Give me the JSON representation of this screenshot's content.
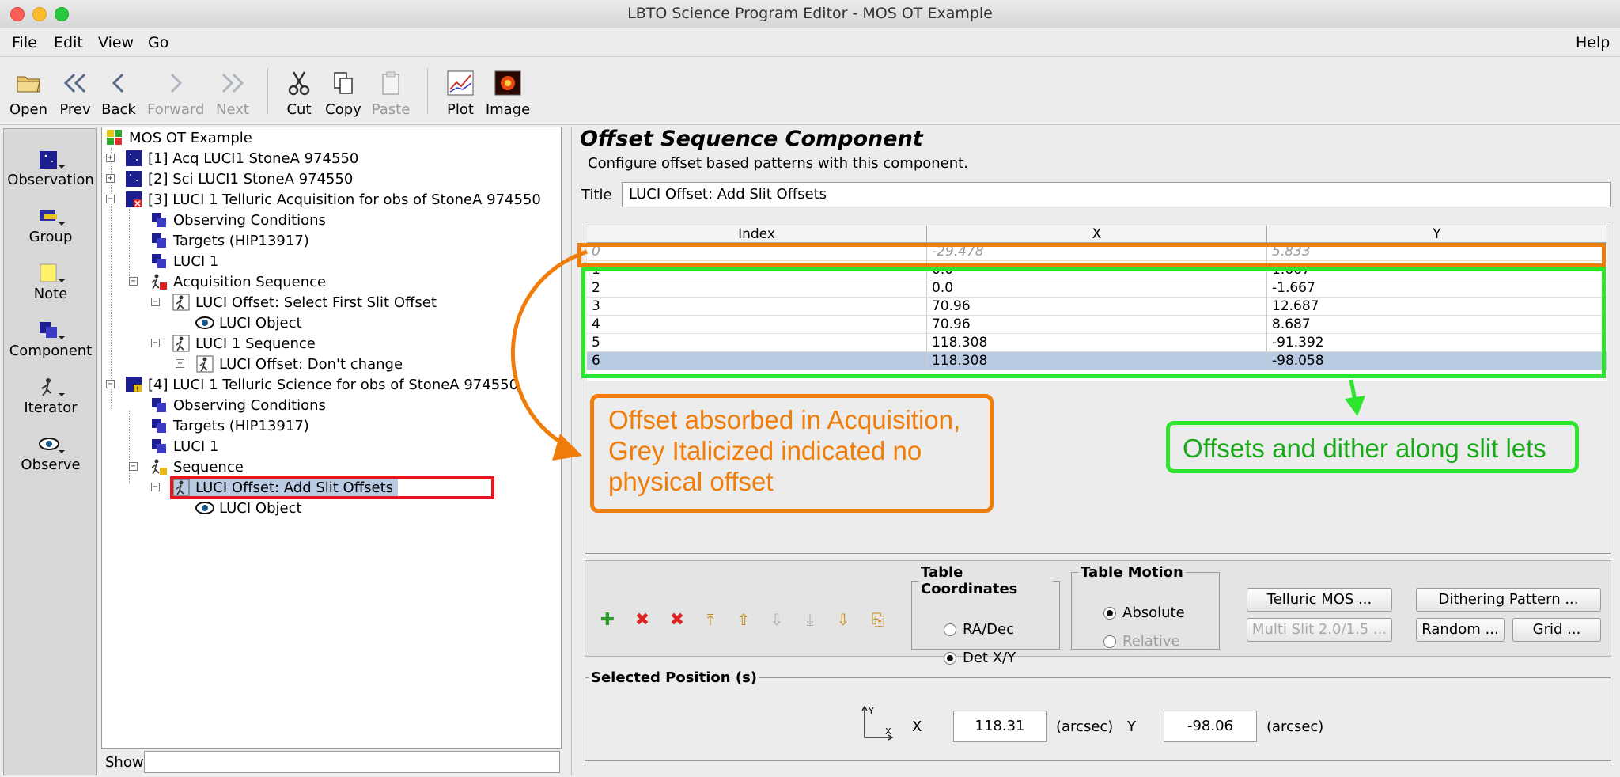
{
  "window": {
    "title": "LBTO Science Program Editor - MOS OT Example"
  },
  "menu": {
    "items": [
      "File",
      "Edit",
      "View",
      "Go"
    ],
    "help": "Help"
  },
  "toolbar": {
    "open": "Open",
    "prev": "Prev",
    "back": "Back",
    "forward": "Forward",
    "next": "Next",
    "cut": "Cut",
    "copy": "Copy",
    "paste": "Paste",
    "plot": "Plot",
    "image": "Image"
  },
  "palette": {
    "observation": "Observation",
    "group": "Group",
    "note": "Note",
    "component": "Component",
    "iterator": "Iterator",
    "observe": "Observe"
  },
  "tree": {
    "root": "MOS OT Example",
    "nodes": [
      "[1] Acq LUCI1 StoneA 974550",
      "[2] Sci LUCI1 StoneA 974550",
      "[3] LUCI 1 Telluric Acquisition for obs of StoneA 974550",
      "Observing Conditions",
      "Targets (HIP13917)",
      "LUCI 1",
      "Acquisition Sequence",
      "LUCI Offset: Select First Slit Offset",
      "LUCI Object",
      "LUCI 1 Sequence",
      "LUCI Offset: Don't change",
      "[4] LUCI 1 Telluric Science for obs of StoneA 974550",
      "Observing Conditions",
      "Targets (HIP13917)",
      "LUCI 1",
      "Sequence",
      "LUCI Offset: Add Slit Offsets",
      "LUCI Object"
    ],
    "show_label": "Show"
  },
  "component": {
    "heading": "Offset Sequence Component",
    "description": "Configure offset based patterns with this component.",
    "title_label": "Title",
    "title_value": "LUCI Offset: Add Slit Offsets"
  },
  "table": {
    "headers": [
      "Index",
      "X",
      "Y"
    ],
    "rows": [
      [
        "0",
        "-29.478",
        "5.833"
      ],
      [
        "1",
        "0.0",
        "1.667"
      ],
      [
        "2",
        "0.0",
        "-1.667"
      ],
      [
        "3",
        "70.96",
        "12.687"
      ],
      [
        "4",
        "70.96",
        "8.687"
      ],
      [
        "5",
        "118.308",
        "-91.392"
      ],
      [
        "6",
        "118.308",
        "-98.058"
      ]
    ]
  },
  "annotations": {
    "orange_lines": [
      "Offset absorbed in Acquisition,",
      "Grey Italicized indicated no",
      "physical offset"
    ],
    "green": "Offsets and dither along slit lets",
    "orange_color": "#f07d0a",
    "green_color": "#2ee52e",
    "red_color": "#e8141e"
  },
  "coords": {
    "legend": "Table Coordinates",
    "radec": "RA/Dec",
    "detxy": "Det X/Y",
    "selected": "Det X/Y"
  },
  "motion": {
    "legend": "Table Motion",
    "absolute": "Absolute",
    "relative": "Relative",
    "selected": "Absolute"
  },
  "buttons": {
    "telluric": "Telluric MOS ...",
    "multislit": "Multi Slit 2.0/1.5 ...",
    "dithering": "Dithering Pattern ...",
    "random": "Random ...",
    "grid": "Grid ..."
  },
  "selected_position": {
    "legend": "Selected Position (s)",
    "x_label": "X",
    "x_value": "118.31",
    "x_unit": "(arcsec)",
    "y_label": "Y",
    "y_value": "-98.06",
    "y_unit": "(arcsec)"
  }
}
